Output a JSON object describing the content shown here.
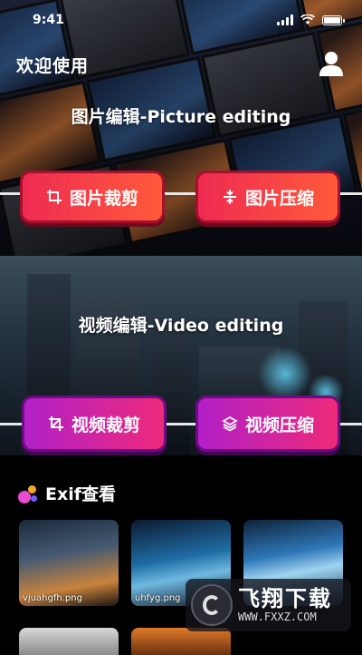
{
  "status_bar": {
    "time": "9:41"
  },
  "header": {
    "greeting": "欢迎使用"
  },
  "picture_section": {
    "title": "图片编辑-Picture editing",
    "crop_button": "图片裁剪",
    "compress_button": "图片压缩"
  },
  "video_section": {
    "title": "视频编辑-Video editing",
    "crop_button": "视频裁剪",
    "compress_button": "视频压缩"
  },
  "exif_section": {
    "title": "Exif查看",
    "thumbnails": [
      {
        "label": "vjuahgfh.png"
      },
      {
        "label": "uhfyg.png"
      },
      {
        "label": ""
      }
    ]
  },
  "watermark": {
    "brand": "飞翔下载",
    "url": "WWW.FXXZ.COM"
  },
  "colors": {
    "red_button": "#ee2b52",
    "purple_button": "#b220c8",
    "background": "#000000"
  }
}
